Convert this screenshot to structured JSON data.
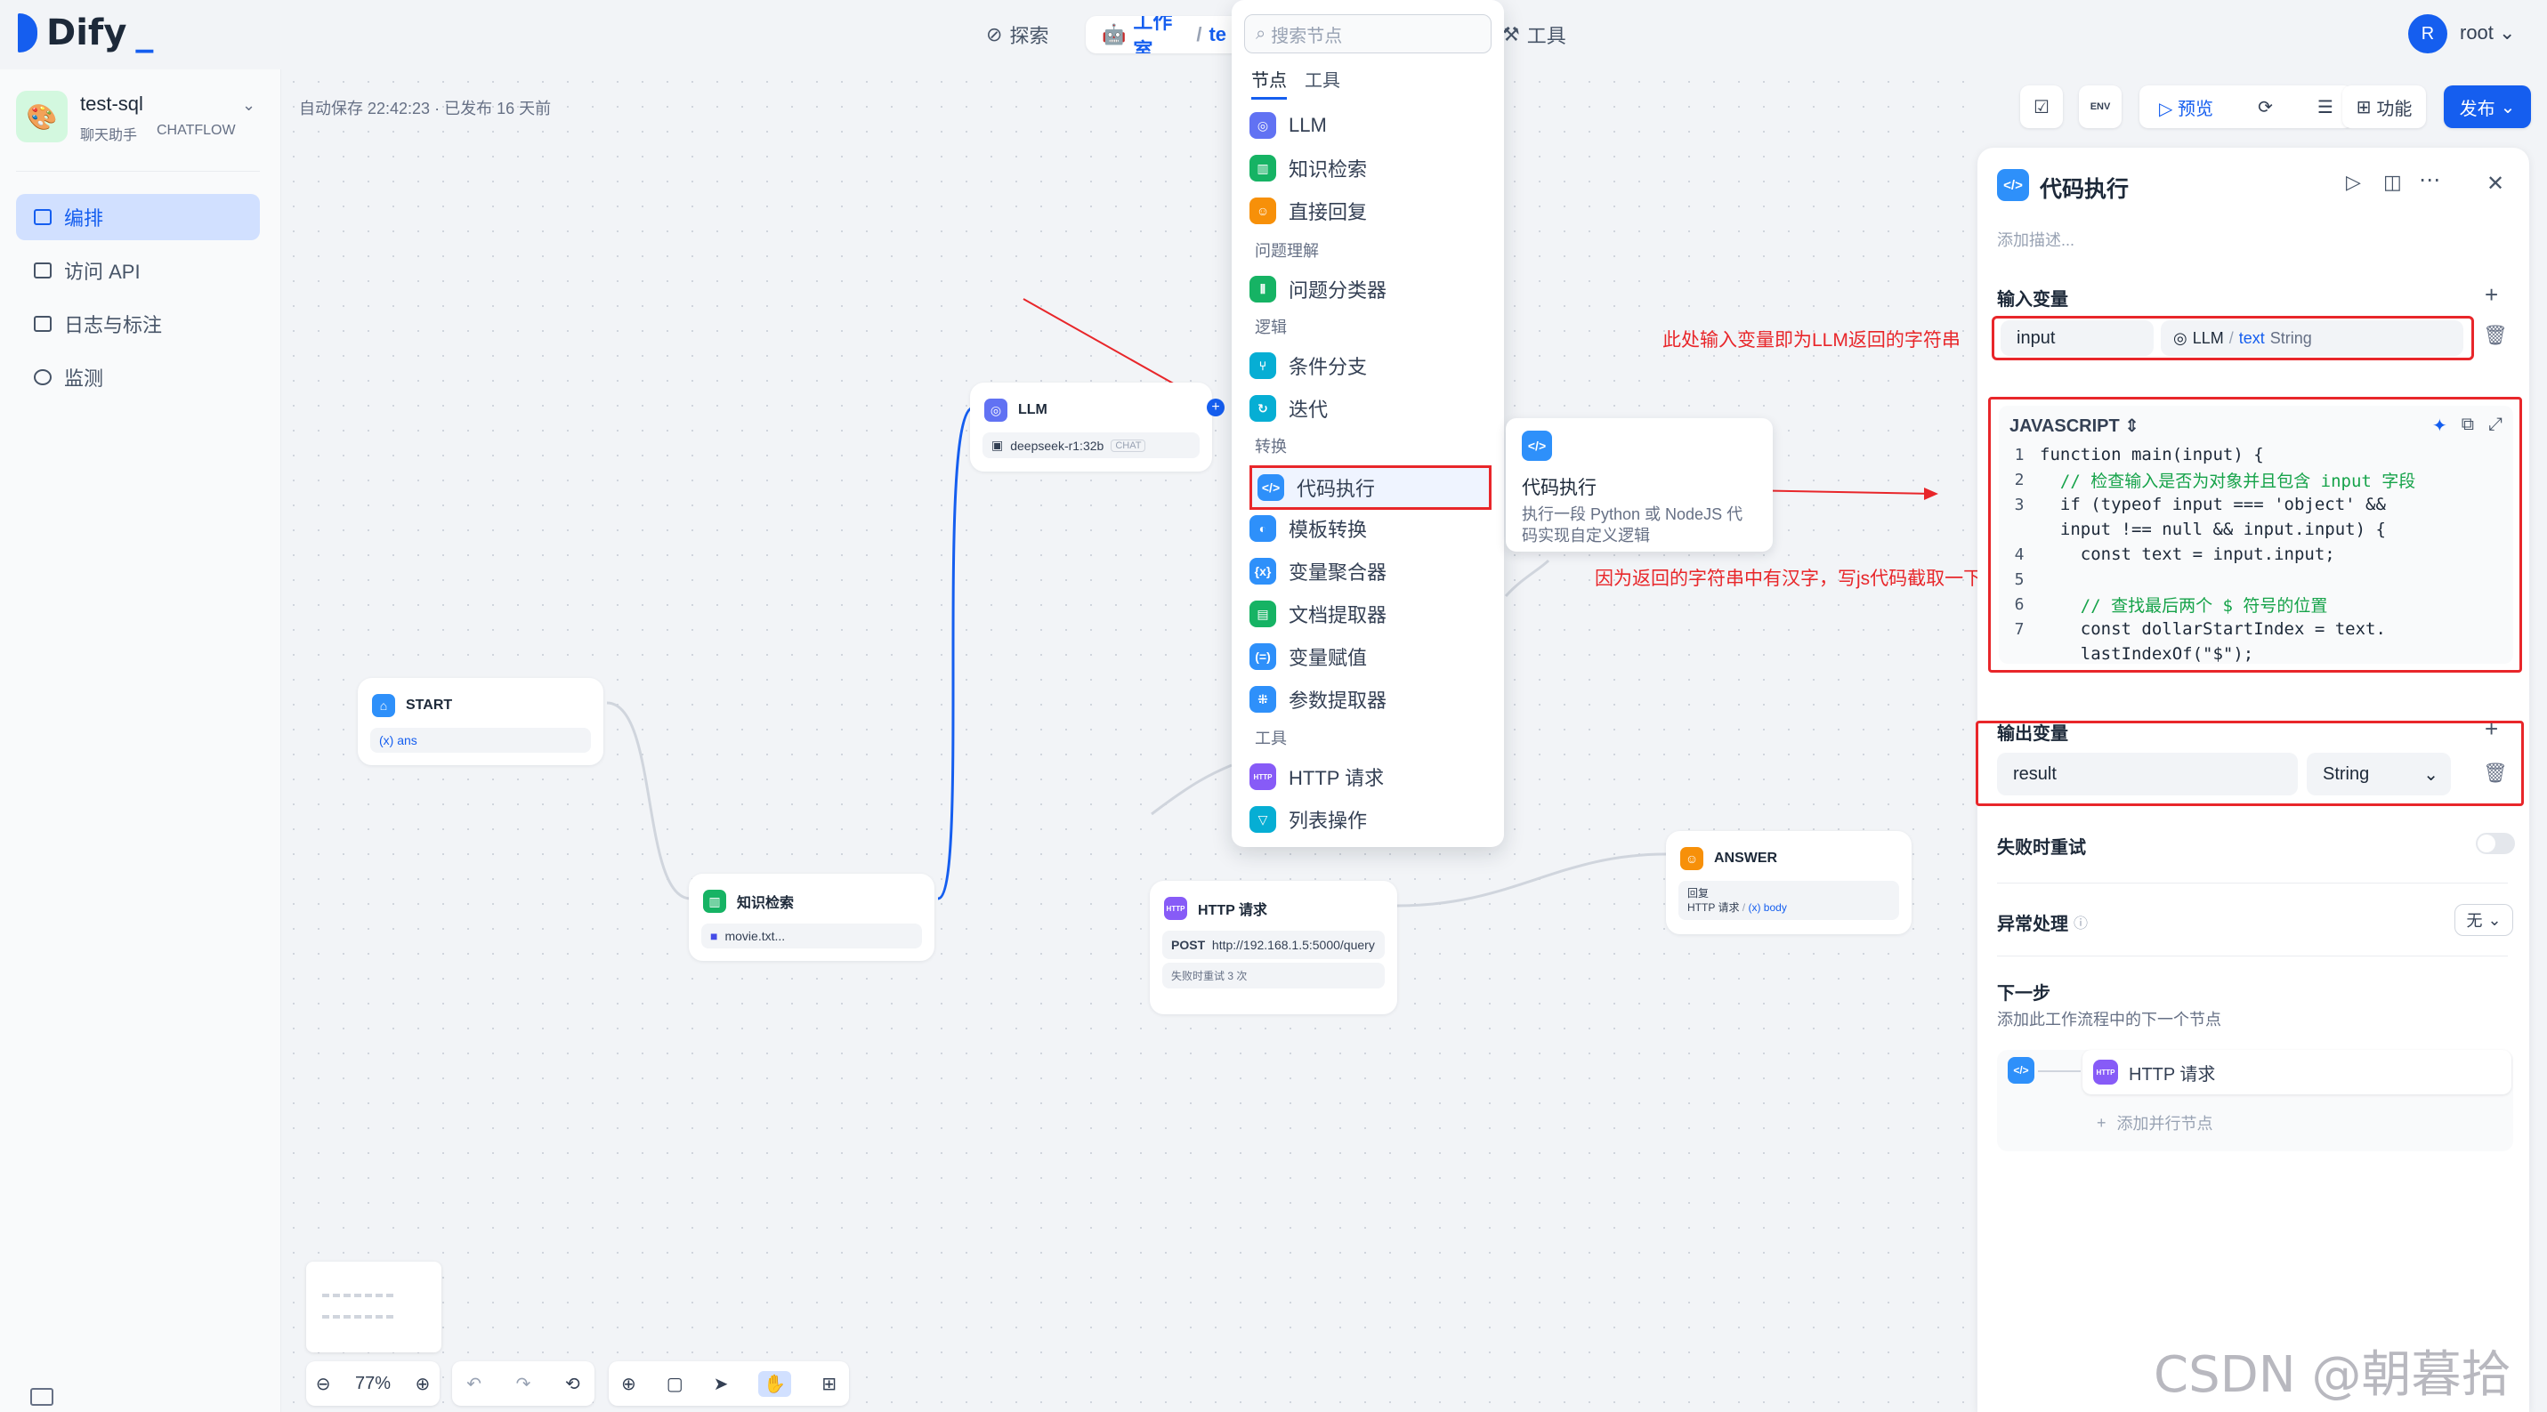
{
  "app": {
    "brand": "Dify",
    "name": "test-sql",
    "type": "聊天助手",
    "mode": "CHATFLOW"
  },
  "topnav": {
    "explore": "探索",
    "studio": "工作室",
    "tools": "工具",
    "studio_sep": "/",
    "studio_trunc": "te"
  },
  "user": {
    "initial": "R",
    "name": "root"
  },
  "sidebar": {
    "items": [
      {
        "label": "编排"
      },
      {
        "label": "访问 API"
      },
      {
        "label": "日志与标注"
      },
      {
        "label": "监测"
      }
    ]
  },
  "canvas": {
    "autosave": "自动保存 22:42:23 · 已发布 16 天前",
    "zoom": "77%"
  },
  "nodes": {
    "start": {
      "title": "START",
      "var": "(x) ans"
    },
    "llm": {
      "title": "LLM",
      "model": "deepseek-r1:32b",
      "tag": "CHAT"
    },
    "knowledge": {
      "title": "知识检索",
      "dataset": "movie.txt..."
    },
    "http": {
      "title": "HTTP 请求",
      "method": "POST",
      "url": "http://192.168.1.5:5000/query",
      "retry": "失败时重试 3 次"
    },
    "answer": {
      "title": "ANSWER",
      "sub": "回复",
      "ref_node": "HTTP 请求",
      "ref_var": "(x) body"
    }
  },
  "picker": {
    "search_placeholder": "搜索节点",
    "tabs": [
      "节点",
      "工具"
    ],
    "groups": {
      "understand": "问题理解",
      "logic": "逻辑",
      "transform": "转换",
      "tools": "工具"
    },
    "items": {
      "llm": "LLM",
      "knowledge": "知识检索",
      "reply": "直接回复",
      "classifier": "问题分类器",
      "ifelse": "条件分支",
      "iteration": "迭代",
      "code": "代码执行",
      "template": "模板转换",
      "aggregator": "变量聚合器",
      "docextract": "文档提取器",
      "assign": "变量赋值",
      "param": "参数提取器",
      "httpreq": "HTTP 请求",
      "listop": "列表操作"
    },
    "tooltip_title": "代码执行",
    "tooltip_desc": "执行一段 Python 或 NodeJS 代码实现自定义逻辑"
  },
  "toolbar": {
    "preview": "预览",
    "features": "功能",
    "publish": "发布",
    "env": "ENV"
  },
  "panel": {
    "title": "代码执行",
    "desc_placeholder": "添加描述...",
    "input_section": "输入变量",
    "input_name": "input",
    "input_src_node": "LLM",
    "input_src_var": "text",
    "input_src_type": "String",
    "language": "JAVASCRIPT",
    "code_lines": [
      {
        "no": "1",
        "text": "function main(input) {"
      },
      {
        "no": "2",
        "text": "  // 检查输入是否为对象并且包含 input 字段"
      },
      {
        "no": "3",
        "text": "  if (typeof input === 'object' &&"
      },
      {
        "no": "",
        "text": "  input !== null && input.input) {"
      },
      {
        "no": "4",
        "text": "    const text = input.input;"
      },
      {
        "no": "5",
        "text": ""
      },
      {
        "no": "6",
        "text": "    // 查找最后两个 $ 符号的位置"
      },
      {
        "no": "7",
        "text": "    const dollarStartIndex = text."
      },
      {
        "no": "",
        "text": "    lastIndexOf(\"$\");"
      }
    ],
    "output_section": "输出变量",
    "output_name": "result",
    "output_type": "String",
    "retry_label": "失败时重试",
    "error_label": "异常处理",
    "error_value": "无",
    "next_title": "下一步",
    "next_desc": "添加此工作流程中的下一个节点",
    "next_node": "HTTP 请求",
    "add_parallel": "添加并行节点"
  },
  "annotations": {
    "input_note": "此处输入变量即为LLM返回的字符串",
    "code_note": "因为返回的字符串中有汉字，写js代码截取一下"
  },
  "watermark": "CSDN @朝暮拾花",
  "colors": {
    "accent": "#155eef",
    "annotation": "#e8262a"
  }
}
